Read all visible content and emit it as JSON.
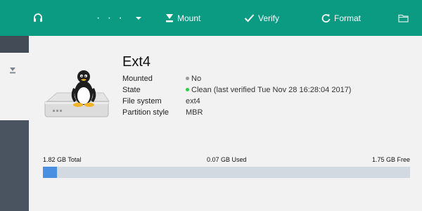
{
  "toolbar": {
    "more_label": "· · ·",
    "mount_label": "Mount",
    "verify_label": "Verify",
    "format_label": "Format",
    "icons": [
      "headset-icon",
      "chevron-down-icon",
      "mount-icon",
      "checkmark-icon",
      "refresh-icon",
      "folder-icon"
    ]
  },
  "partition": {
    "name": "Ext4",
    "properties": [
      {
        "label": "Mounted",
        "value": "No",
        "status_color": "#9a9a9a"
      },
      {
        "label": "State",
        "value": "Clean (last verified Tue Nov 28 16:28:04 2017)",
        "status_color": "#2ecc40"
      },
      {
        "label": "File system",
        "value": "ext4"
      },
      {
        "label": "Partition style",
        "value": "MBR"
      }
    ]
  },
  "usage": {
    "total_label": "1.82 GB Total",
    "used_label": "0.07 GB Used",
    "free_label": "1.75 GB Free",
    "used_fraction": 0.0385
  },
  "colors": {
    "toolbar_bg": "#0b9a82",
    "sidebar_bg": "#4a5460",
    "bar_track": "#d3d9e1",
    "bar_fill": "#4a90e2"
  }
}
